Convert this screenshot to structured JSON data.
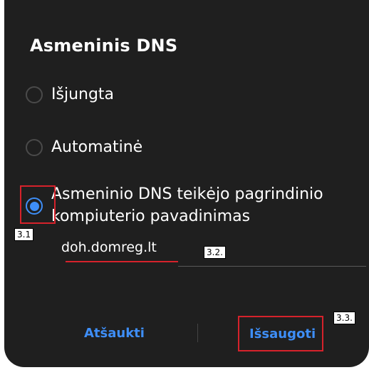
{
  "dialog": {
    "title": "Asmeninis DNS",
    "options": [
      {
        "label": "Išjungta",
        "checked": false
      },
      {
        "label": "Automatinė",
        "checked": false
      },
      {
        "label": "Asmeninio DNS teikėjo pagrindinio kompiuterio pavadinimas",
        "checked": true
      }
    ],
    "hostname_value": "doh.domreg.lt",
    "cancel_label": "Atšaukti",
    "save_label": "Išsaugoti"
  },
  "annotations": {
    "tag_1": "3.1",
    "tag_2": "3.2.",
    "tag_3": "3.3."
  },
  "colors": {
    "background": "#1f1f1f",
    "accent": "#3e8ef7",
    "highlight": "#d6222b"
  }
}
